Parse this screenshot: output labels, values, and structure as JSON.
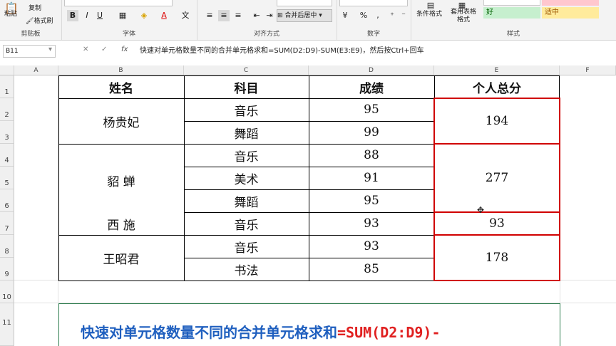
{
  "ribbon": {
    "clipboard": {
      "paste": "粘贴",
      "copy": "复制",
      "format_painter": "格式刷",
      "label": "剪贴板"
    },
    "font": {
      "bold": "B",
      "italic": "I",
      "underline": "U",
      "font_color": "A",
      "label": "字体"
    },
    "alignment": {
      "merge_center": "合并后居中",
      "label": "对齐方式"
    },
    "number": {
      "percent": "%",
      "comma": ",",
      "label": "数字"
    },
    "styles": {
      "conditional": "条件格式",
      "table_format": "套用表格格式",
      "good": "好",
      "neutral": "适中",
      "label": "样式"
    }
  },
  "formula_bar": {
    "name_box": "B11",
    "fx": "fx",
    "content": "快速对单元格数量不同的合并单元格求和=SUM(D2:D9)-SUM(E3:E9)，然后按Ctrl+回车"
  },
  "columns": [
    "A",
    "B",
    "C",
    "D",
    "E",
    "F"
  ],
  "rows": [
    "1",
    "2",
    "3",
    "4",
    "5",
    "6",
    "7",
    "8",
    "9",
    "10",
    "11"
  ],
  "table": {
    "headers": {
      "name": "姓名",
      "subject": "科目",
      "score": "成绩",
      "total": "个人总分"
    },
    "names": [
      "杨贵妃",
      "貂  蝉",
      "西  施",
      "王昭君"
    ],
    "subjects": [
      "音乐",
      "舞蹈",
      "音乐",
      "美术",
      "舞蹈",
      "音乐",
      "音乐",
      "书法"
    ],
    "scores": [
      "95",
      "99",
      "88",
      "91",
      "95",
      "93",
      "93",
      "85"
    ],
    "totals": [
      "194",
      "277",
      "93",
      "178"
    ]
  },
  "note": {
    "text": "快速对单元格数量不同的合并单元格求和",
    "formula": "=SUM(D2:D9)-",
    "text_color": "#1f5fbf",
    "formula_color": "#e02020"
  },
  "colors": {
    "red_border": "#d00000"
  }
}
